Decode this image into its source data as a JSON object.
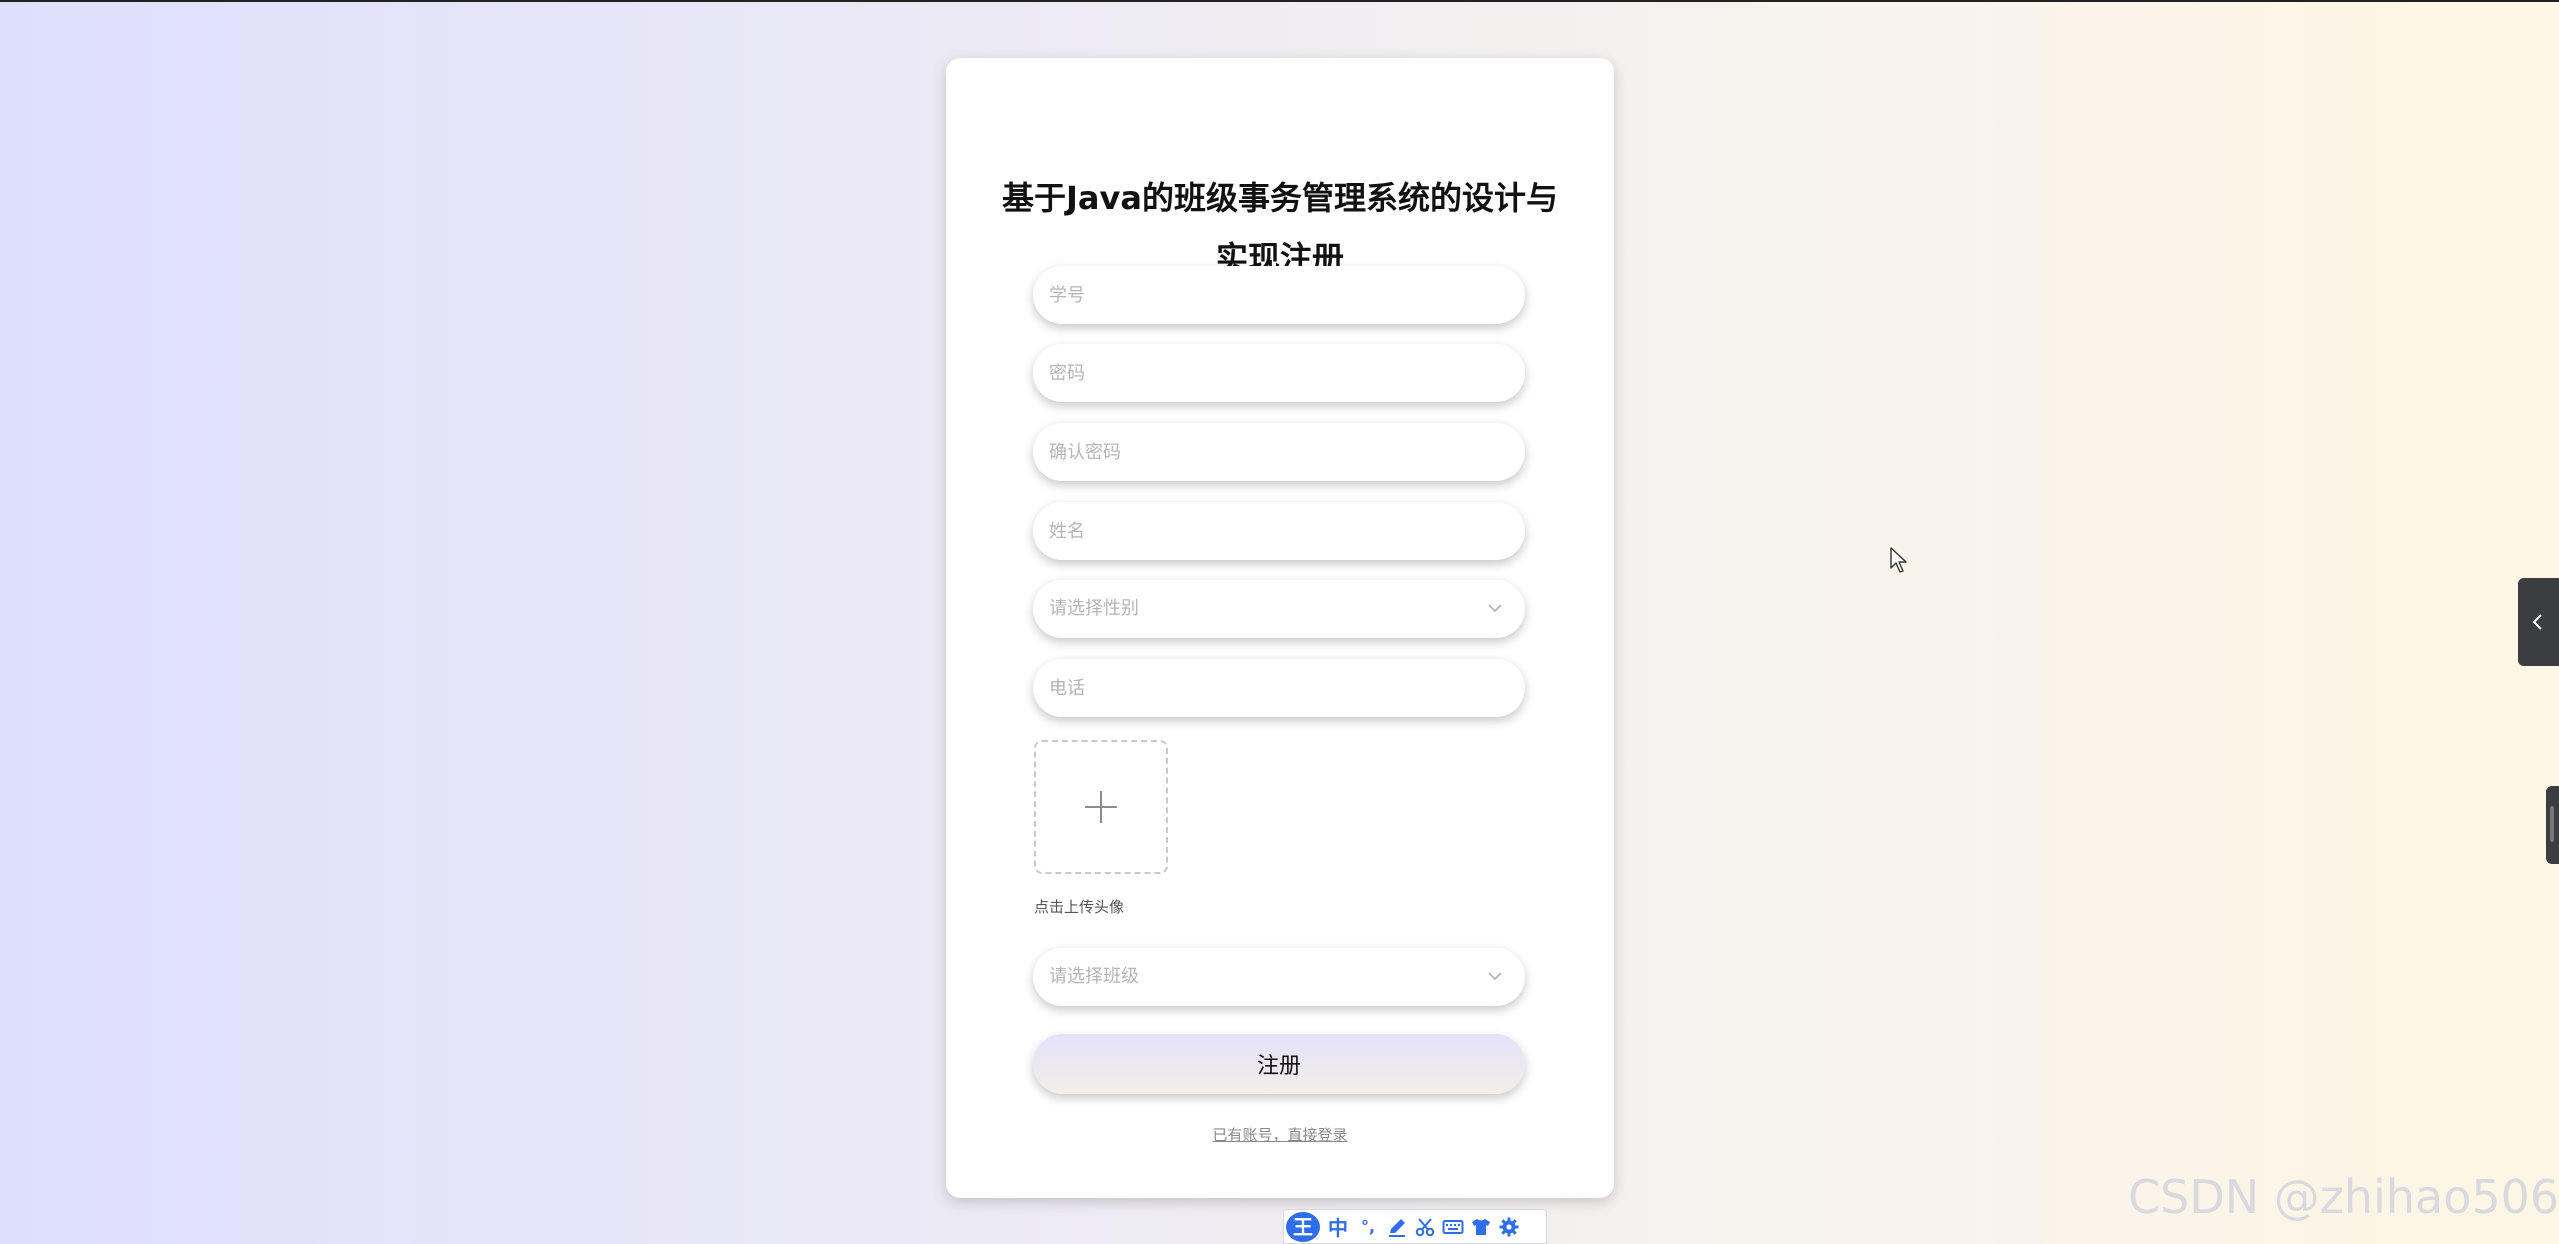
{
  "form": {
    "title_line1": "基于Java的班级事务管理系统的设计与",
    "title_line2": "实现注册",
    "student_id_placeholder": "学号",
    "password_placeholder": "密码",
    "confirm_password_placeholder": "确认密码",
    "name_placeholder": "姓名",
    "gender_placeholder": "请选择性别",
    "phone_placeholder": "电话",
    "upload_tip": "点击上传头像",
    "class_placeholder": "请选择班级",
    "submit_label": "注册",
    "login_link": "已有账号，直接登录"
  },
  "ime_toolbar": {
    "logo": "王",
    "mode": "中",
    "punct": "°,"
  },
  "watermark": "CSDN @zhihao506",
  "colors": {
    "ime_blue": "#2f6ee8",
    "card_bg": "#ffffff",
    "placeholder": "#b5b5b5"
  },
  "icons": [
    "chevron-down-icon",
    "plus-icon",
    "cursor-icon",
    "chevron-left-icon",
    "pen-icon",
    "scissors-icon",
    "keyboard-icon",
    "shirt-icon",
    "gear-icon"
  ]
}
